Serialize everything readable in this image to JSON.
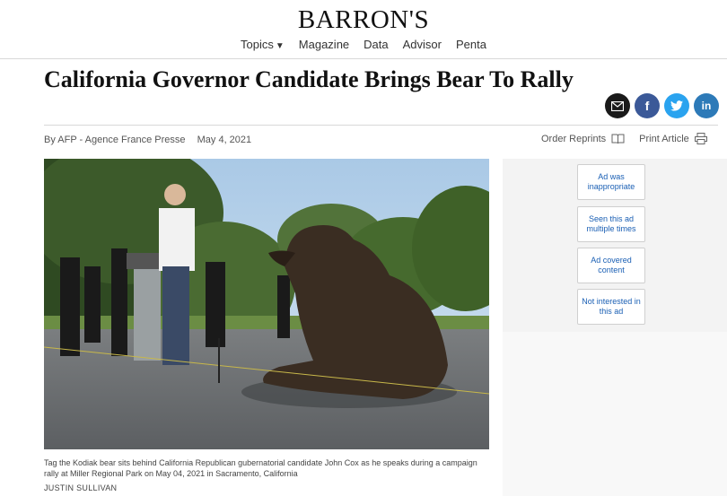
{
  "masthead": {
    "logo": "BARRON'S",
    "nav": [
      "Topics",
      "Magazine",
      "Data",
      "Advisor",
      "Penta"
    ]
  },
  "article": {
    "headline": "California Governor Candidate Brings Bear To Rally",
    "byline": "By AFP - Agence France Presse",
    "date": "May 4, 2021",
    "tools": {
      "reprints": "Order Reprints",
      "print": "Print Article"
    },
    "share": {
      "email": "email-icon",
      "facebook": "f",
      "twitter": "twitter-icon",
      "linkedin": "in"
    },
    "caption": "Tag the Kodiak bear sits behind California Republican gubernatorial candidate John Cox as he speaks during a campaign rally at Miller Regional Park on May 04, 2021 in Sacramento, California",
    "credit": "JUSTIN SULLIVAN"
  },
  "ad_feedback": [
    "Ad was inappropriate",
    "Seen this ad multiple times",
    "Ad covered content",
    "Not interested in this ad"
  ]
}
